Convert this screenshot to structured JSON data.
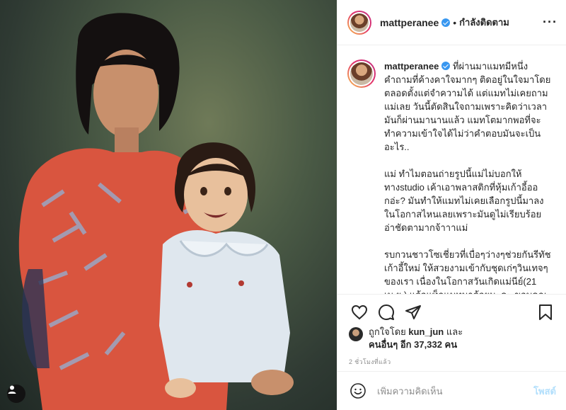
{
  "post": {
    "username": "mattperanee",
    "dot": "•",
    "follow_label": "กำลังติดตาม",
    "more_label": "···"
  },
  "caption": {
    "username": "mattperanee",
    "paragraphs": [
      "ที่ผ่านมาแมทมีหนึ่งคำถามที่ค้างคาใจมากๆ ติดอยู่ในใจมาโดยตลอดตั้งแต่จำความได้ แต่แมทไม่เคยถามแม่เลย วันนี้ตัดสินใจถามเพราะคิดว่าเวลามันก็ผ่านมานานแล้ว แมทโตมากพอที่จะทำความเข้าใจได้ไม่ว่าคำตอบมันจะเป็นอะไร..",
      "แม่ ทำไมตอนถ่ายรูปนี้แม่ไม่บอกให้ทางstudio เค้าเอาพลาสติกที่หุ้มเก้าอี้ออกอ่ะ? มันทำให้แมทไม่เคยเลือกรูปนี้มาลงในโอกาสไหนเลยเพราะมันดูไม่เรียบร้อยอ่าชัดตามากจ้าาาแม่",
      "รบกวนชาวโซเชี่ยวที่เบื่อๆว่างๆช่วยกันรีทัชเก้าอี้ใหม่ ให้สวยงามเข้ากับชุดเก่ๆวินเทจๆของเรา เนื่องในโอกาสวันเกิดแม่นีย์(21 เม.ย.) แล้วแท็กแมทมาด้วยนะคะ ขอบคุณจ้าาาา"
    ],
    "trailing_emoji": "❤️ 🙏"
  },
  "likes": {
    "prefix": "ถูกใจโดย",
    "liker": "kun_jun",
    "and": "และ",
    "others_label": "คนอื่นๆ อีก 37,332 คน"
  },
  "timestamp": "2 ชั่วโมงที่แล้ว",
  "comment": {
    "placeholder": "เพิ่มความคิดเห็น",
    "post_label": "โพสต์"
  },
  "icons": {
    "like": "heart-icon",
    "comment": "comment-icon",
    "share": "share-icon",
    "save": "bookmark-icon",
    "emoji": "smiley-icon",
    "user_tag": "user-tag-icon",
    "verified": "verified-badge-icon"
  },
  "colors": {
    "verified": "#3897f0",
    "post_button_disabled": "#b2dffc",
    "heart": "#ed4956"
  }
}
